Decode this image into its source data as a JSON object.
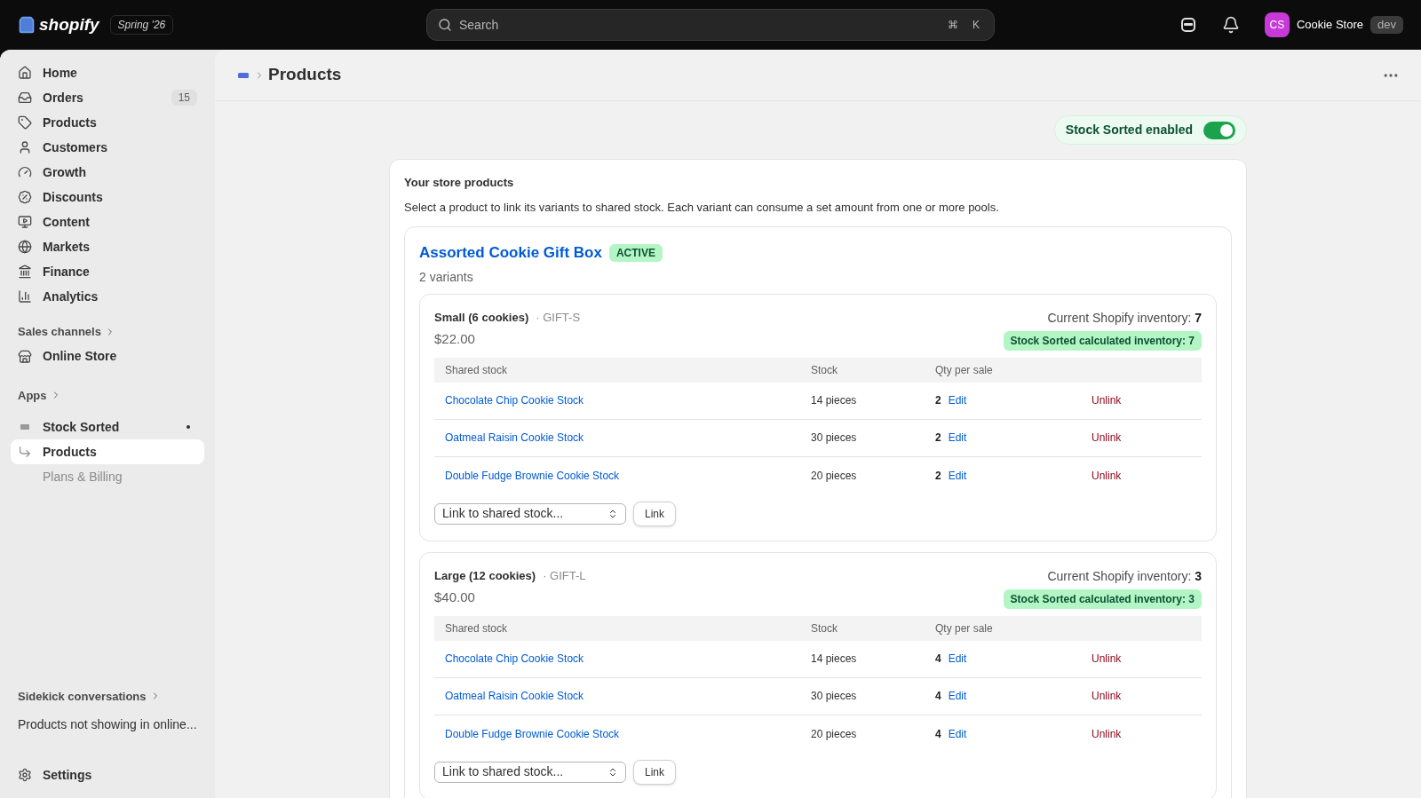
{
  "topbar": {
    "logo": "shopify",
    "edition": "Spring '26",
    "search": {
      "placeholder": "Search"
    },
    "shortcut": [
      "⌘",
      "K"
    ],
    "store": {
      "initials": "CS",
      "name": "Cookie Store",
      "badge": "dev"
    }
  },
  "sidebar": {
    "items": [
      {
        "label": "Home",
        "selected": false
      },
      {
        "label": "Orders",
        "badge": "15",
        "selected": false
      },
      {
        "label": "Products",
        "selected": false
      },
      {
        "label": "Customers",
        "selected": false
      },
      {
        "label": "Growth",
        "selected": false
      },
      {
        "label": "Discounts",
        "selected": false
      },
      {
        "label": "Content",
        "selected": false
      },
      {
        "label": "Markets",
        "selected": false
      },
      {
        "label": "Finance",
        "selected": false
      },
      {
        "label": "Analytics",
        "selected": false
      }
    ],
    "sales_channels": {
      "heading": "Sales channels",
      "items": [
        {
          "label": "Online Store",
          "selected": false
        }
      ]
    },
    "apps": {
      "heading": "Apps",
      "app": {
        "label": "Stock Sorted",
        "children": [
          {
            "label": "Products",
            "selected": true
          },
          {
            "label": "Plans & Billing",
            "selected": false
          }
        ]
      }
    },
    "sidekick": {
      "heading": "Sidekick conversations",
      "items": [
        {
          "label": "Products not showing in online..."
        }
      ]
    },
    "settings": "Settings"
  },
  "page": {
    "breadcrumb": "Products",
    "toggle": {
      "label": "Stock Sorted enabled",
      "on": true
    },
    "card": {
      "title": "Your store products",
      "description": "Select a product to link its variants to shared stock. Each variant can consume a set amount from one or more pools.",
      "product": {
        "name": "Assorted Cookie Gift Box",
        "status": "ACTIVE",
        "variant_count": "2 variants",
        "variants": [
          {
            "name": "Small (6 cookies)",
            "sku": "· GIFT-S",
            "price": "$22.00",
            "inventory_label": "Current Shopify inventory:",
            "inventory": "7",
            "calculated": "Stock Sorted calculated inventory: 7",
            "columns": [
              "Shared stock",
              "Stock",
              "Qty per sale"
            ],
            "rows": [
              {
                "stock": "Chocolate Chip Cookie Stock",
                "amount": "14 pieces",
                "qty": "2",
                "edit": "Edit",
                "unlink": "Unlink"
              },
              {
                "stock": "Oatmeal Raisin Cookie Stock",
                "amount": "30 pieces",
                "qty": "2",
                "edit": "Edit",
                "unlink": "Unlink"
              },
              {
                "stock": "Double Fudge Brownie Cookie Stock",
                "amount": "20 pieces",
                "qty": "2",
                "edit": "Edit",
                "unlink": "Unlink"
              }
            ],
            "select": {
              "placeholder": "Link to shared stock..."
            },
            "button": "Link"
          },
          {
            "name": "Large (12 cookies)",
            "sku": "· GIFT-L",
            "price": "$40.00",
            "inventory_label": "Current Shopify inventory:",
            "inventory": "3",
            "calculated": "Stock Sorted calculated inventory: 3",
            "columns": [
              "Shared stock",
              "Stock",
              "Qty per sale"
            ],
            "rows": [
              {
                "stock": "Chocolate Chip Cookie Stock",
                "amount": "14 pieces",
                "qty": "4",
                "edit": "Edit",
                "unlink": "Unlink"
              },
              {
                "stock": "Oatmeal Raisin Cookie Stock",
                "amount": "30 pieces",
                "qty": "4",
                "edit": "Edit",
                "unlink": "Unlink"
              },
              {
                "stock": "Double Fudge Brownie Cookie Stock",
                "amount": "20 pieces",
                "qty": "4",
                "edit": "Edit",
                "unlink": "Unlink"
              }
            ],
            "select": {
              "placeholder": "Link to shared stock..."
            },
            "button": "Link"
          }
        ]
      }
    }
  }
}
